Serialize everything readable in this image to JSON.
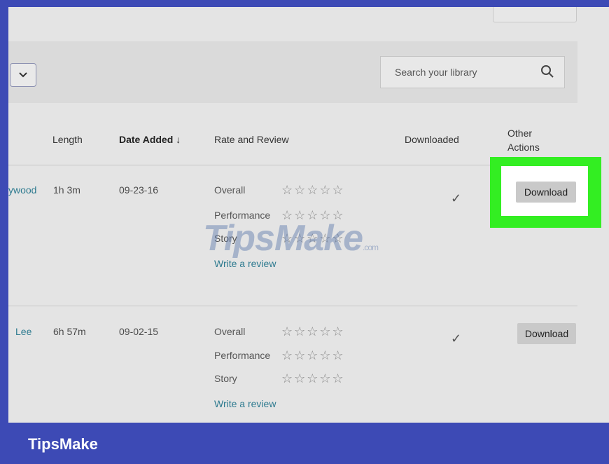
{
  "search": {
    "placeholder": "Search your library"
  },
  "columns": {
    "length": "Length",
    "date_added": "Date Added ↓",
    "rate_review": "Rate and Review",
    "downloaded": "Downloaded",
    "other_actions": "Other Actions"
  },
  "rows": [
    {
      "title_fragment": "ywood",
      "length": "1h 3m",
      "date": "09-23-16",
      "ratings": [
        {
          "label": "Overall",
          "stars": 0
        },
        {
          "label": "Performance",
          "stars": 0
        },
        {
          "label": "Story",
          "stars": 0
        }
      ],
      "review_link": "Write a review",
      "downloaded_mark": "✓",
      "action": "Download"
    },
    {
      "title_fragment": "Lee",
      "length": "6h 57m",
      "date": "09-02-15",
      "ratings": [
        {
          "label": "Overall",
          "stars": 0
        },
        {
          "label": "Performance",
          "stars": 0
        },
        {
          "label": "Story",
          "stars": 0
        }
      ],
      "review_link": "Write a review",
      "downloaded_mark": "✓",
      "action": "Download"
    }
  ],
  "stars_glyph": "☆☆☆☆☆",
  "watermark": {
    "main": "TipsMake",
    "suffix": ".com"
  },
  "brand": "TipsMake",
  "colors": {
    "frame": "#3d4ab5",
    "highlight": "#33ee22",
    "link": "#2d7a8f"
  }
}
